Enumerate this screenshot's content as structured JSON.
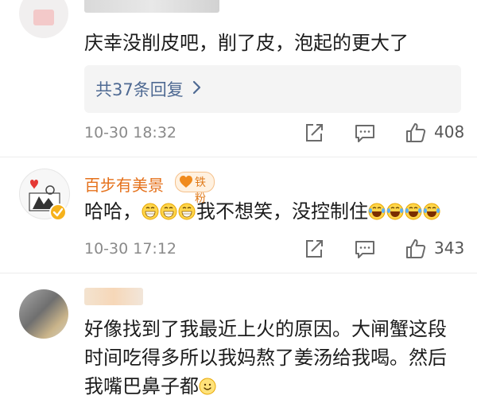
{
  "comments": [
    {
      "text": "庆幸没削皮吧，削了皮，泡起的更大了",
      "replies_label": "共37条回复",
      "time": "10-30 18:32",
      "likes": "408"
    },
    {
      "username": "百步有美景",
      "badge": "铁粉",
      "text_pre": "哈哈，",
      "text_mid": "我不想笑，没控制住",
      "time": "10-30 17:12",
      "likes": "343"
    },
    {
      "text_line1": "好像找到了我最近上火的原因。大闸蟹这段",
      "text_line2": "时间吃得多所以我妈熬了姜汤给我喝。然后",
      "text_line3": "我嘴巴鼻子都"
    }
  ],
  "colors": {
    "username": "#e5711b",
    "reply_link": "#4f6a93",
    "meta": "#8a8a8a",
    "reply_bg": "#f4f4f4"
  }
}
